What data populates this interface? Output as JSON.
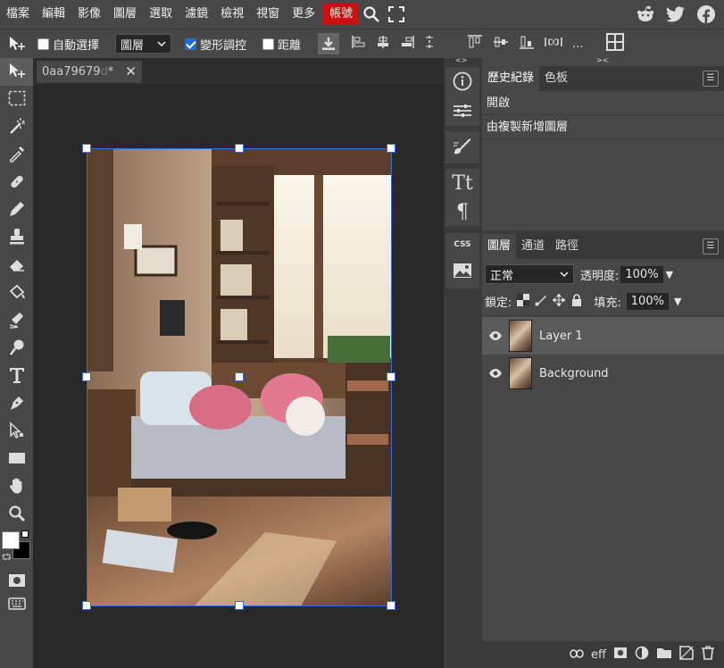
{
  "menu": {
    "items": [
      "檔案",
      "編輯",
      "影像",
      "圖層",
      "選取",
      "濾鏡",
      "檢視",
      "視窗",
      "更多"
    ],
    "account": "帳號"
  },
  "options": {
    "auto_select_label": "自動選擇",
    "auto_select_checked": false,
    "target_value": "圖層",
    "transform_label": "變形調控",
    "transform_checked": true,
    "distance_label": "距離",
    "distance_checked": false,
    "more": "..."
  },
  "document": {
    "tab_name": "0aa79679",
    "tab_fade": "d",
    "modified_marker": " *"
  },
  "history_panel": {
    "tabs": [
      "歷史紀錄",
      "色板"
    ],
    "items": [
      "開啟",
      "由複製新增圖層"
    ]
  },
  "layers_panel": {
    "tabs": [
      "圖層",
      "通道",
      "路徑"
    ],
    "blend_mode": "正常",
    "opacity_label": "透明度:",
    "opacity_value": "100%",
    "lock_label": "鎖定:",
    "fill_label": "填充:",
    "fill_value": "100%",
    "layers": [
      {
        "name": "Layer 1",
        "selected": true
      },
      {
        "name": "Background",
        "selected": false
      }
    ],
    "footer_eff": "eff"
  },
  "midbar": {
    "type_tool": "Tt",
    "paragraph": "¶",
    "css": "CSS"
  },
  "colors": {
    "accent": "#1e6fd9",
    "account_red": "#c90f0f",
    "primary_color": "#ffffff",
    "secondary_color": "#000000"
  }
}
